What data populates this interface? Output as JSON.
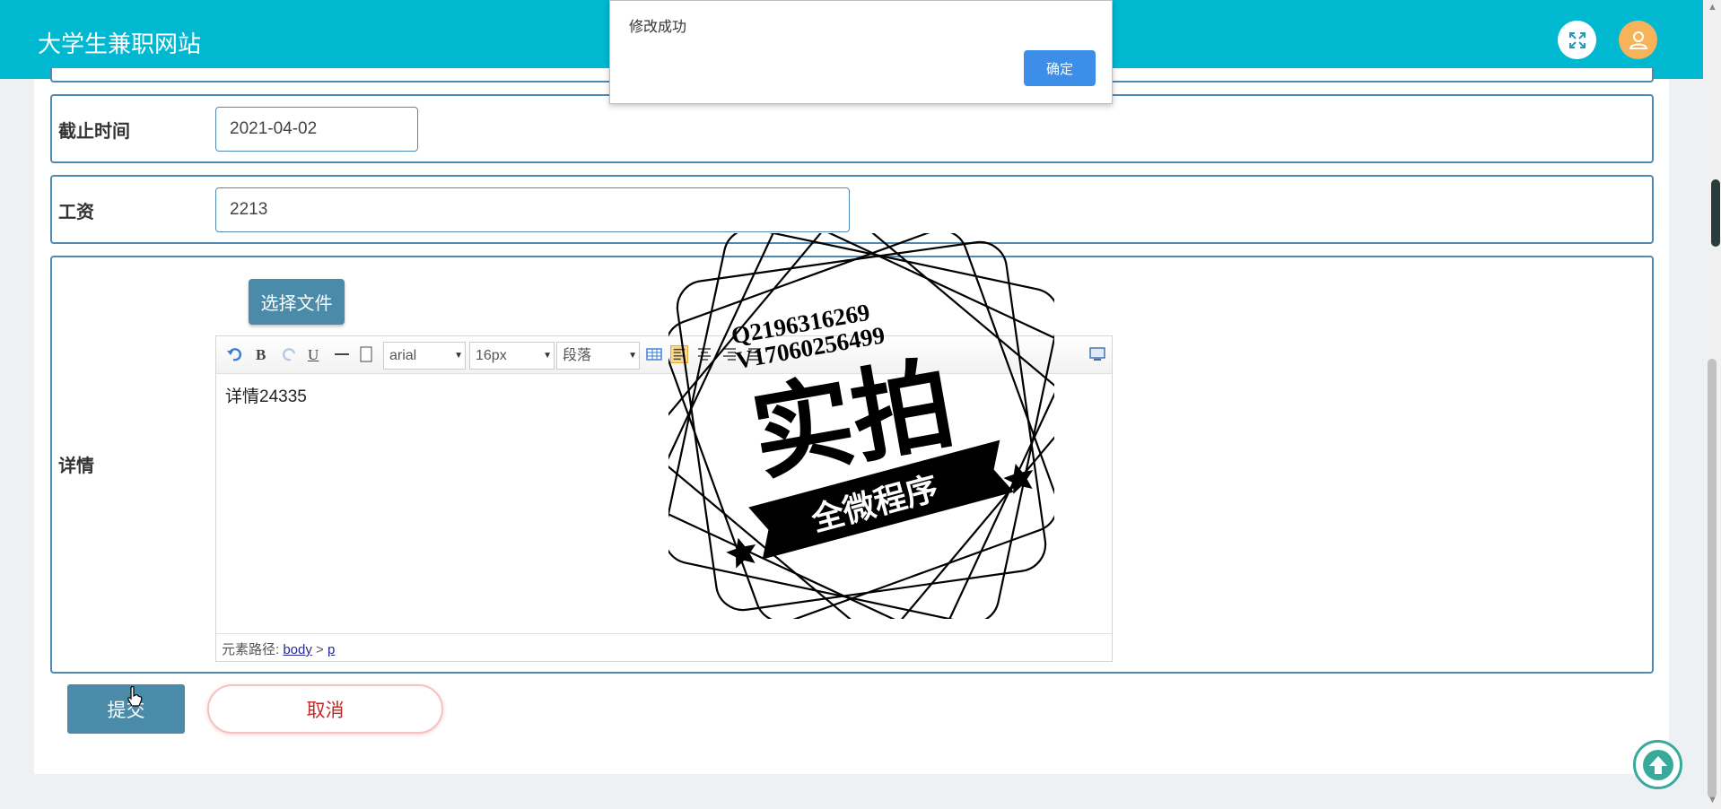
{
  "header": {
    "title": "大学生兼职网站"
  },
  "form": {
    "deadline": {
      "label": "截止时间",
      "value": "2021-04-02"
    },
    "salary": {
      "label": "工资",
      "value": "2213"
    },
    "detail": {
      "label": "详情",
      "file_button": "选择文件",
      "toolbar": {
        "font_family": "arial",
        "font_size": "16px",
        "paragraph": "段落",
        "bold": "B",
        "underline": "U"
      },
      "content": "详情24335",
      "path_label": "元素路径:",
      "path_body": "body",
      "path_sep": ">",
      "path_p": "p"
    }
  },
  "actions": {
    "submit": "提交",
    "cancel": "取消"
  },
  "dialog": {
    "message": "修改成功",
    "ok": "确定"
  },
  "watermark": {
    "qq": "Q2196316269",
    "v": "V17060256499",
    "main": "实拍",
    "banner": "全微程序"
  },
  "colors": {
    "header": "#00b9d1",
    "primary_button": "#4a8ba9",
    "border": "#4f8ab5",
    "dialog_ok": "#3d8ee8"
  }
}
